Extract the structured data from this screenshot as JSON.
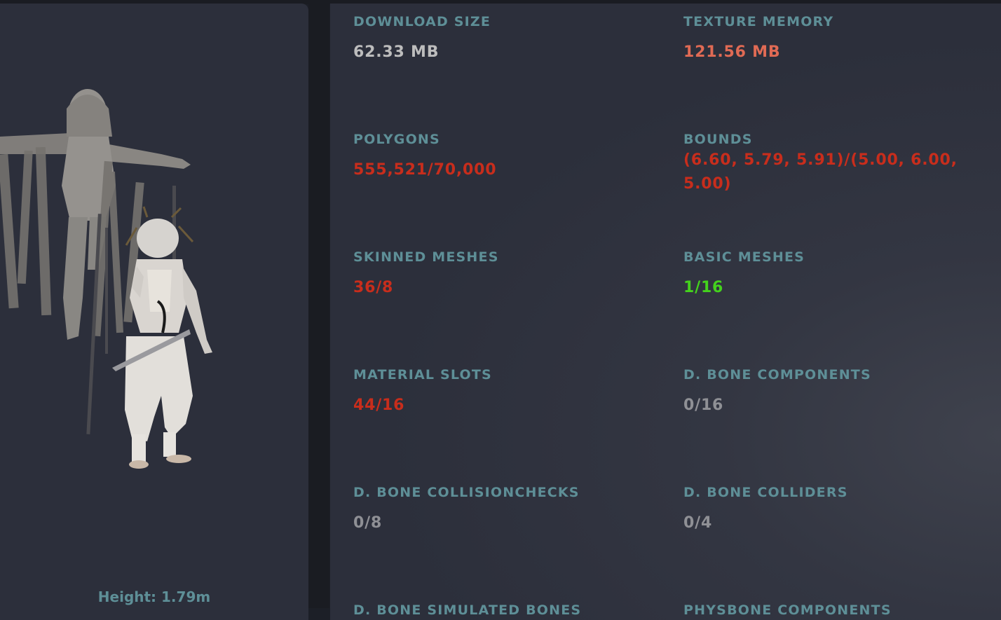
{
  "preview": {
    "height_label": "Height: 1.79m"
  },
  "stats": [
    {
      "label": "DOWNLOAD SIZE",
      "value": "62.33 MB",
      "status": "neutral"
    },
    {
      "label": "TEXTURE MEMORY",
      "value": "121.56 MB",
      "status": "warning"
    },
    {
      "label": "POLYGONS",
      "value": "555,521/70,000",
      "status": "over"
    },
    {
      "label": "BOUNDS",
      "value": "(6.60, 5.79, 5.91)/(5.00, 6.00, 5.00)",
      "status": "over"
    },
    {
      "label": "SKINNED MESHES",
      "value": "36/8",
      "status": "over"
    },
    {
      "label": "BASIC MESHES",
      "value": "1/16",
      "status": "ok"
    },
    {
      "label": "MATERIAL SLOTS",
      "value": "44/16",
      "status": "over"
    },
    {
      "label": "D. BONE COMPONENTS",
      "value": "0/16",
      "status": "zero"
    },
    {
      "label": "D. BONE COLLISIONCHECKS",
      "value": "0/8",
      "status": "zero"
    },
    {
      "label": "D. BONE COLLIDERS",
      "value": "0/4",
      "status": "zero"
    },
    {
      "label": "D. BONE SIMULATED BONES",
      "value": "",
      "status": "zero"
    },
    {
      "label": "PHYSBONE COMPONENTS",
      "value": "",
      "status": "zero"
    }
  ],
  "colors": {
    "label": "#5e8f97",
    "neutral": "#bdbdbd",
    "zero": "#8f9095",
    "over": "#c82d1c",
    "warning": "#e06a54",
    "ok": "#44d21d",
    "panel": "#2c2f3b"
  }
}
